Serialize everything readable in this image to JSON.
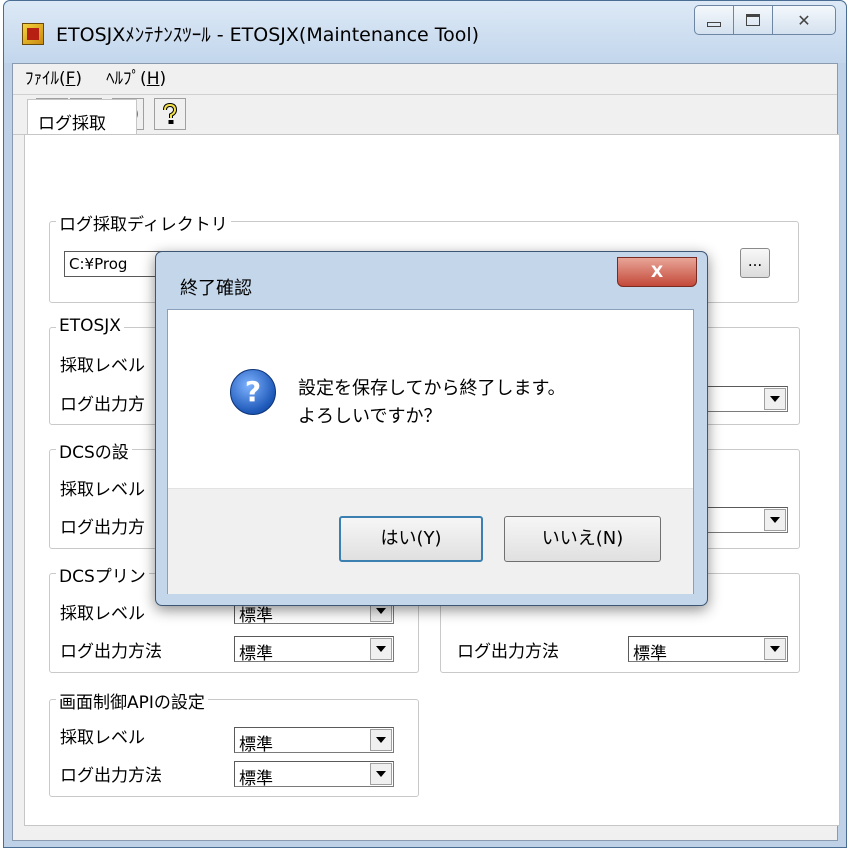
{
  "window": {
    "title": "ETOSJXﾒﾝﾃﾅﾝｽﾂｰﾙ - ETOSJX(Maintenance Tool)"
  },
  "menu": [
    {
      "label": "ﾌｧｲﾙ(",
      "key": "F",
      "end": ")"
    },
    {
      "label": "ﾍﾙﾌﾟ(",
      "key": "H",
      "end": ")"
    }
  ],
  "toolbar": {
    "icons": [
      "save-icon",
      "close-icon",
      "refresh-icon",
      "help-icon"
    ]
  },
  "tab": {
    "label": "ログ採取"
  },
  "log_dir": {
    "title": "ログ採取ディレクトリ",
    "value": "C:¥Prog",
    "browse_label": "..."
  },
  "groups": {
    "etosjx": {
      "title": "ETOSJX",
      "level_label": "採取レベル",
      "output_label": "ログ出力方"
    },
    "dcs": {
      "title": "DCSの設",
      "level_label": "採取レベル",
      "output_label": "ログ出力方"
    },
    "dcs_print": {
      "title": "DCSプリン",
      "level_label": "採取レベル",
      "level_value": "標準",
      "output_label": "ログ出力方法",
      "output_value": "標準"
    },
    "right3": {
      "output_label": "ログ出力方法",
      "output_value": "標準"
    },
    "screen_api": {
      "title": "画面制御APIの設定",
      "level_label": "採取レベル",
      "level_value": "標準",
      "output_label": "ログ出力方法",
      "output_value": "標準"
    }
  },
  "dialog": {
    "title": "終了確認",
    "close_label": "X",
    "message_line1": "設定を保存してから終了します。",
    "message_line2": "よろしいですか？",
    "icon": "?",
    "yes_label": "はい(Y)",
    "no_label": "いいえ(N)"
  }
}
